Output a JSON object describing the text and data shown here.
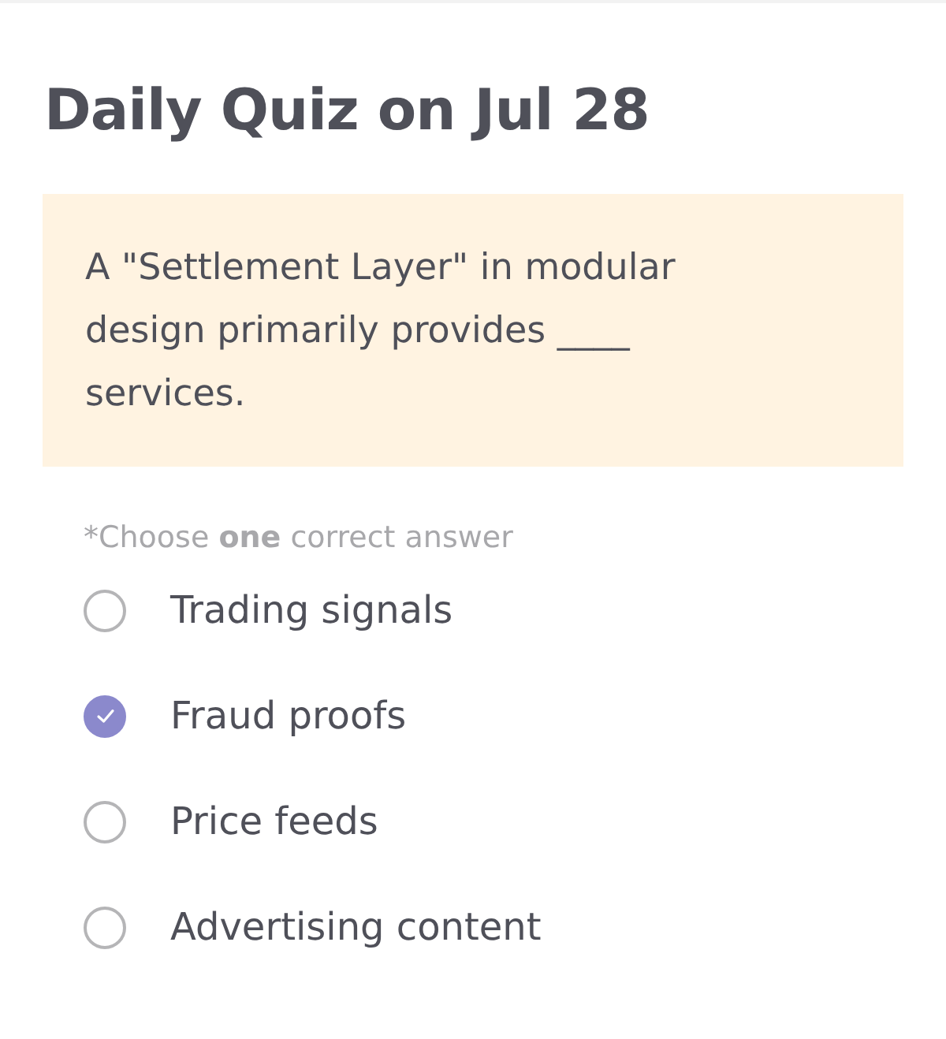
{
  "title": "Daily Quiz on Jul 28",
  "question": "A \"Settlement Layer\" in modular design primarily provides ____ services.",
  "instruction": "*Choose **one** correct answer",
  "options": [
    {
      "label": "Trading signals",
      "selected": false
    },
    {
      "label": "Fraud proofs",
      "selected": true
    },
    {
      "label": "Price feeds",
      "selected": false
    },
    {
      "label": "Advertising content",
      "selected": false
    }
  ]
}
